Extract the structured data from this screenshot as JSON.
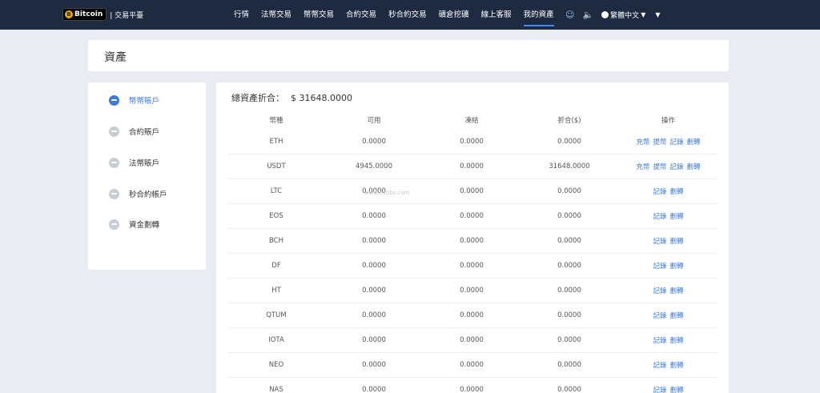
{
  "brand": {
    "coin_glyph": "B",
    "name": "Bitcoin",
    "subtitle": "| 交易平臺"
  },
  "nav": [
    "行情",
    "法幣交易",
    "幣幣交易",
    "合約交易",
    "秒合約交易",
    "礦倉挖礦",
    "線上客服",
    "我的資產"
  ],
  "nav_active": "我的資產",
  "header_icons": [
    "user-icon",
    "speaker-icon"
  ],
  "language": "繁體中文",
  "page_title": "資產",
  "sidebar": [
    {
      "label": "幣幣賬戶",
      "active": true
    },
    {
      "label": "合約賬戶",
      "active": false
    },
    {
      "label": "法幣賬戶",
      "active": false
    },
    {
      "label": "秒合約帳戶",
      "active": false
    },
    {
      "label": "資金劃轉",
      "active": false
    }
  ],
  "total": {
    "label": "總資產折合：",
    "value": "$ 31648.0000"
  },
  "table": {
    "headers": [
      "幣種",
      "可用",
      "凍結",
      "折合($)",
      "操作"
    ],
    "rows": [
      {
        "coin": "ETH",
        "available": "0.0000",
        "frozen": "0.0000",
        "equiv": "0.0000",
        "actions": [
          "充幣",
          "提幣",
          "記錄",
          "劃轉"
        ]
      },
      {
        "coin": "USDT",
        "available": "4945.0000",
        "frozen": "0.0000",
        "equiv": "31648.0000",
        "actions": [
          "充幣",
          "提幣",
          "記錄",
          "劃轉"
        ]
      },
      {
        "coin": "LTC",
        "available": "0.0000",
        "frozen": "0.0000",
        "equiv": "0.0000",
        "actions": [
          "記錄",
          "劃轉"
        ]
      },
      {
        "coin": "EOS",
        "available": "0.0000",
        "frozen": "0.0000",
        "equiv": "0.0000",
        "actions": [
          "記錄",
          "劃轉"
        ]
      },
      {
        "coin": "BCH",
        "available": "0.0000",
        "frozen": "0.0000",
        "equiv": "0.0000",
        "actions": [
          "記錄",
          "劃轉"
        ]
      },
      {
        "coin": "DF",
        "available": "0.0000",
        "frozen": "0.0000",
        "equiv": "0.0000",
        "actions": [
          "記錄",
          "劃轉"
        ]
      },
      {
        "coin": "HT",
        "available": "0.0000",
        "frozen": "0.0000",
        "equiv": "0.0000",
        "actions": [
          "記錄",
          "劃轉"
        ]
      },
      {
        "coin": "QTUM",
        "available": "0.0000",
        "frozen": "0.0000",
        "equiv": "0.0000",
        "actions": [
          "記錄",
          "劃轉"
        ]
      },
      {
        "coin": "IOTA",
        "available": "0.0000",
        "frozen": "0.0000",
        "equiv": "0.0000",
        "actions": [
          "記錄",
          "劃轉"
        ]
      },
      {
        "coin": "NEO",
        "available": "0.0000",
        "frozen": "0.0000",
        "equiv": "0.0000",
        "actions": [
          "記錄",
          "劃轉"
        ]
      },
      {
        "coin": "NAS",
        "available": "0.0000",
        "frozen": "0.0000",
        "equiv": "0.0000",
        "actions": [
          "記錄",
          "劃轉"
        ]
      }
    ]
  },
  "watermark": "www.ecbbs.com",
  "colors": {
    "topbar": "#1e2a40",
    "accent": "#3d7bd4",
    "background": "#e9edf3"
  }
}
